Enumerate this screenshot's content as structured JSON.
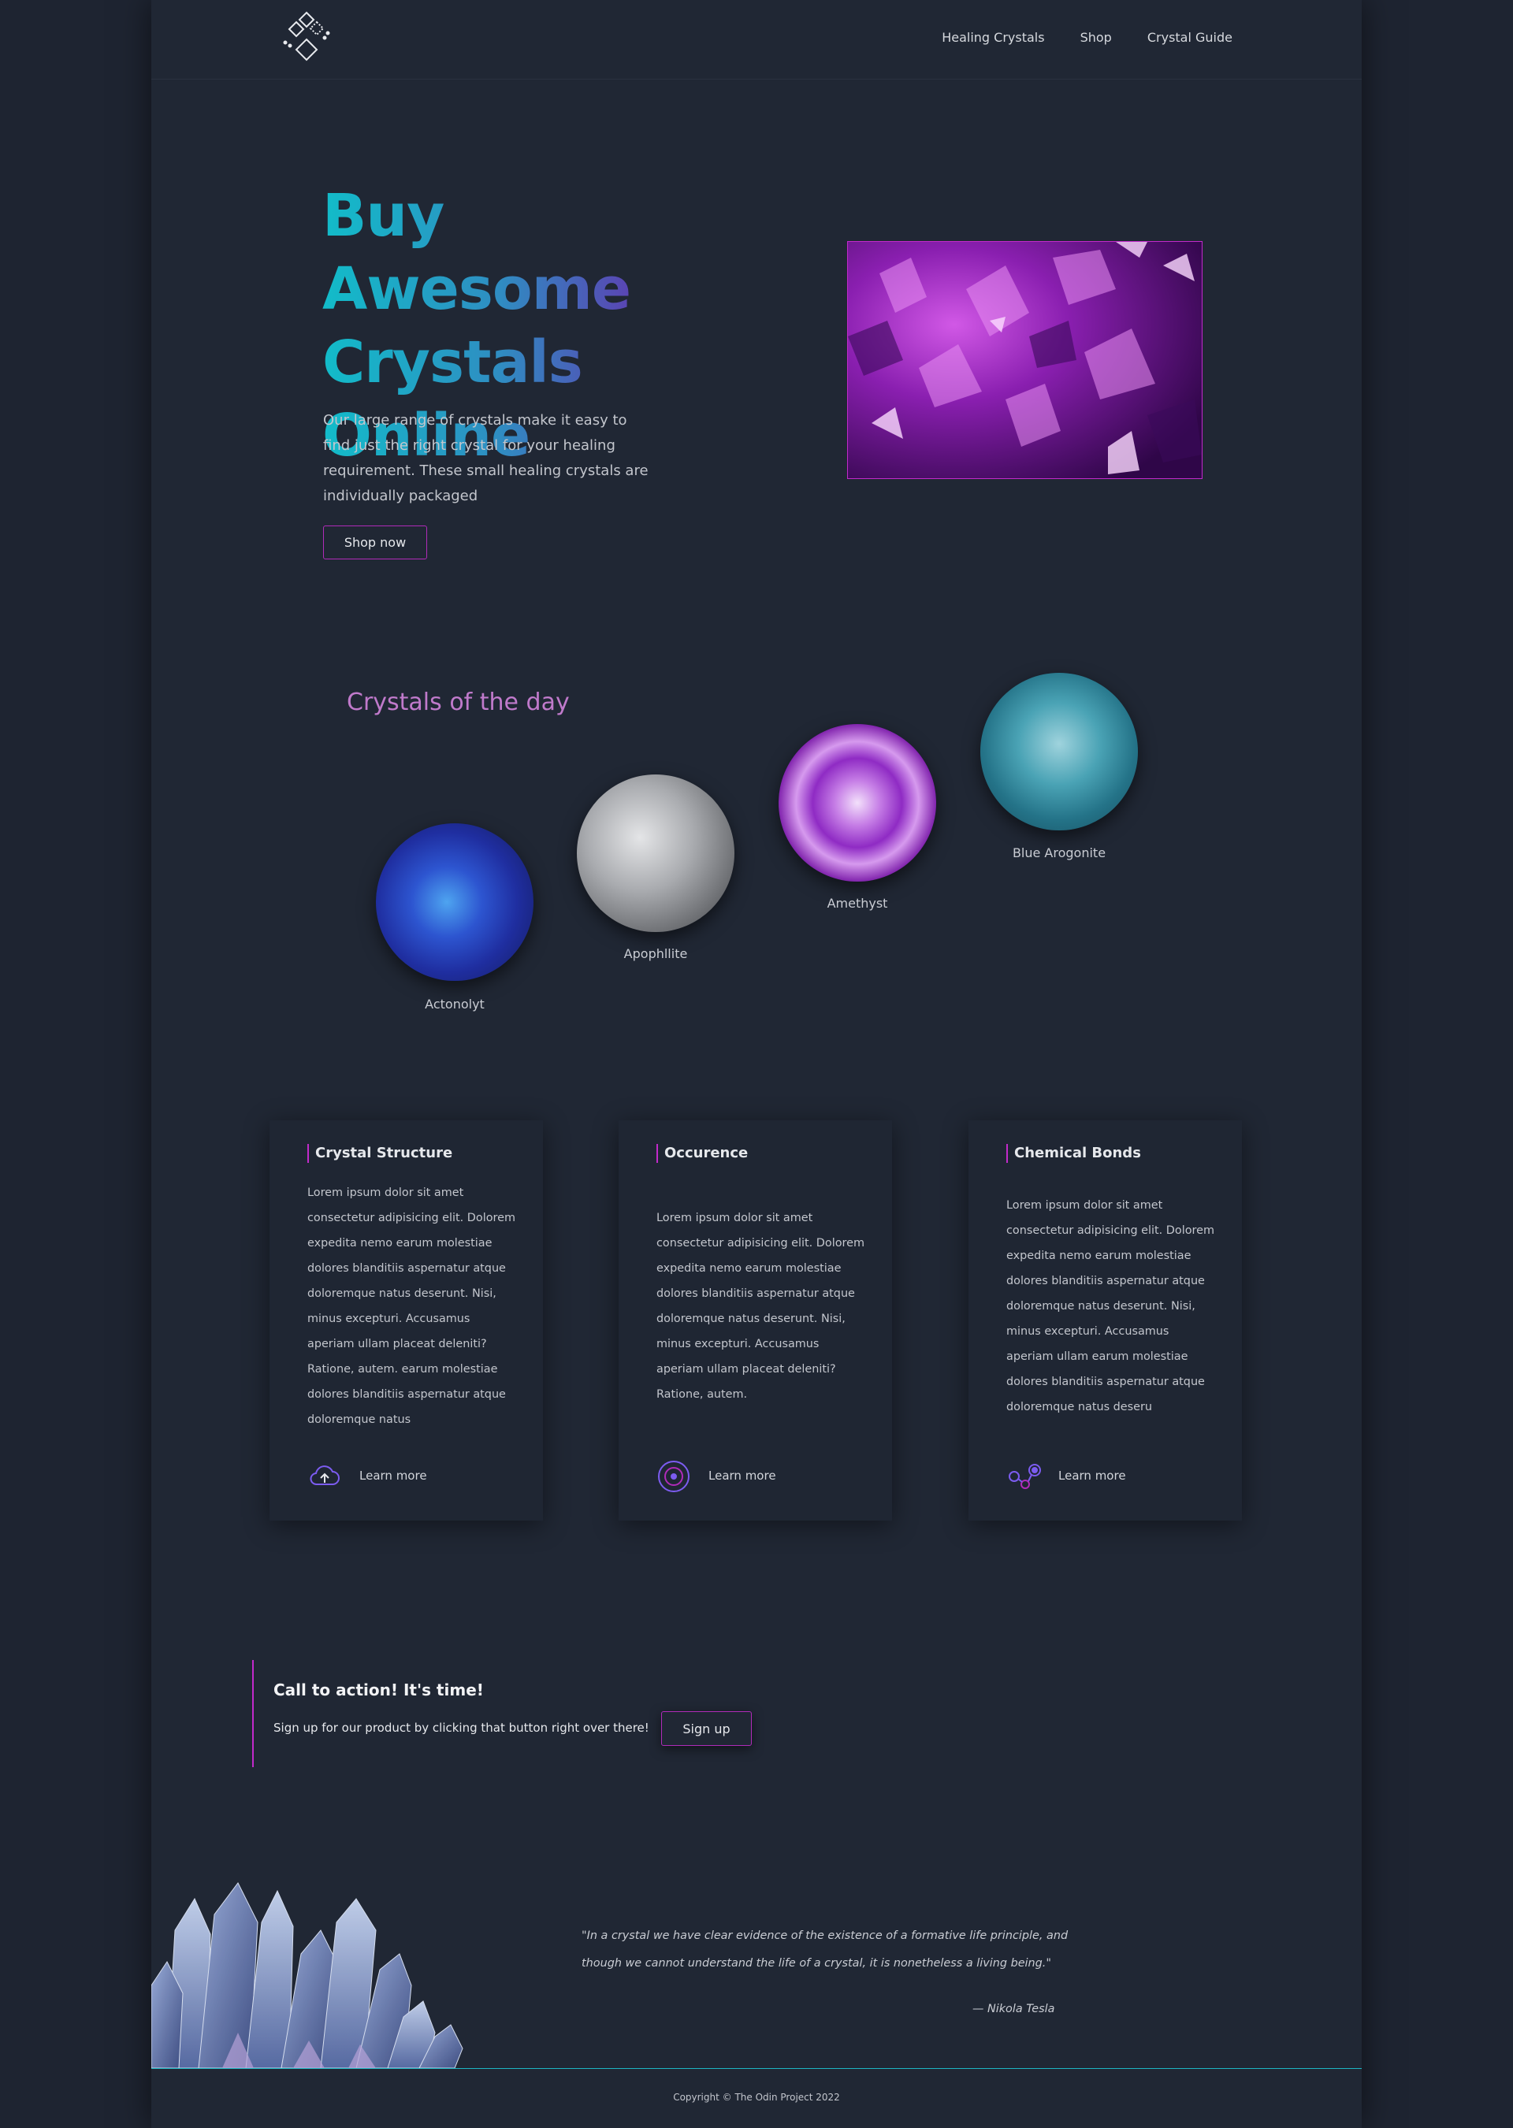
{
  "nav": {
    "items": [
      "Healing Crystals",
      "Shop",
      "Crystal Guide"
    ]
  },
  "hero": {
    "title_line1": "Buy Awesome",
    "title_line2": "Crystals",
    "title_line3": "Online",
    "text": "Our large range of crystals make it easy to find just the right crystal for your healing requirement. These small healing crystals are individually packaged",
    "button": "Shop now"
  },
  "crystals_of_day": {
    "title": "Crystals of the day",
    "items": [
      {
        "name": "Actonolyt",
        "color": "#2a43b8"
      },
      {
        "name": "Apophllite",
        "color": "#9a9da3"
      },
      {
        "name": "Amethyst",
        "color": "#b44ad6"
      },
      {
        "name": "Blue Arogonite",
        "color": "#2a7f93"
      }
    ]
  },
  "cards": [
    {
      "title": "Crystal Structure",
      "body": "Lorem ipsum dolor sit amet consectetur adipisicing elit. Dolorem expedita nemo earum molestiae dolores blanditiis aspernatur atque doloremque natus deserunt. Nisi, minus excepturi. Accusamus aperiam ullam placeat deleniti? Ratione, autem. earum molestiae dolores blanditiis aspernatur atque doloremque natus",
      "link": "Learn more",
      "icon": "cloud-upload-icon"
    },
    {
      "title": "Occurence",
      "body": "Lorem ipsum dolor sit amet consectetur adipisicing elit. Dolorem expedita nemo earum molestiae dolores blanditiis aspernatur atque doloremque natus deserunt. Nisi, minus excepturi. Accusamus aperiam ullam placeat deleniti? Ratione, autem.",
      "link": "Learn more",
      "icon": "target-icon"
    },
    {
      "title": "Chemical Bonds",
      "body": "Lorem ipsum dolor sit amet consectetur adipisicing elit. Dolorem expedita nemo earum molestiae dolores blanditiis aspernatur atque doloremque natus deserunt. Nisi, minus excepturi. Accusamus aperiam ullam earum molestiae dolores blanditiis aspernatur atque doloremque natus deseru",
      "link": "Learn more",
      "icon": "molecule-icon"
    }
  ],
  "cta": {
    "title": "Call to action! It's time!",
    "text": "Sign up for our product by clicking that button right over there!",
    "button": "Sign up"
  },
  "quote": {
    "text": "\"In a crystal we have clear evidence of the existence of a formative life principle, and though we cannot understand the life of a crystal, it is nonetheless a living being.\"",
    "author": "— Nikola Tesla"
  },
  "footer": {
    "copyright": "Copyright © The Odin Project 2022"
  },
  "colors": {
    "accent": "#c22acb",
    "gradient_start": "#12bcc9",
    "gradient_end": "#7b3aa8",
    "background": "#202734"
  }
}
